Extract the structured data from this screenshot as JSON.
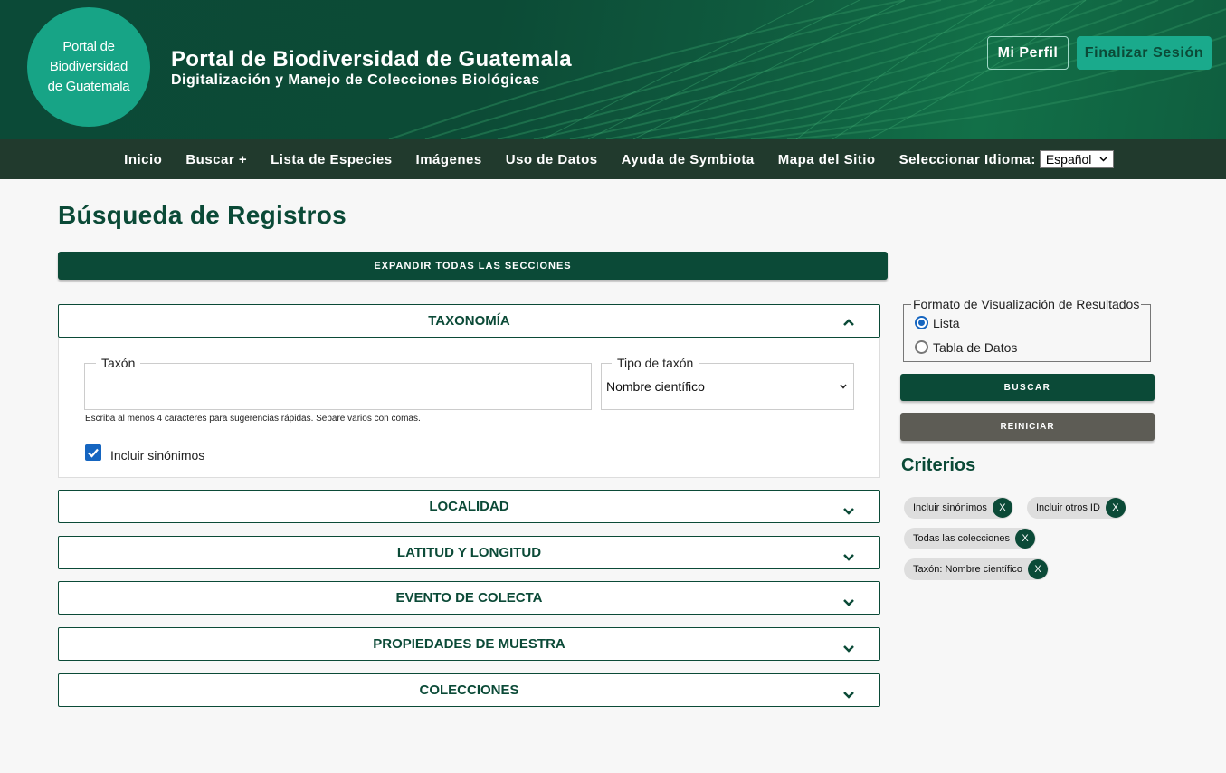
{
  "header": {
    "logo_lines": [
      "Portal de",
      "Biodiversidad",
      "de Guatemala"
    ],
    "title": "Portal de Biodiversidad de Guatemala",
    "subtitle": "Digitalización y Manejo de Colecciones Biológicas",
    "profile_label": "Mi Perfil",
    "logout_label": "Finalizar Sesión"
  },
  "nav": {
    "items": [
      "Inicio",
      "Buscar +",
      "Lista de Especies",
      "Imágenes",
      "Uso de Datos",
      "Ayuda de Symbiota",
      "Mapa del Sitio"
    ],
    "language_label": "Seleccionar Idioma:",
    "language_value": "Español"
  },
  "page": {
    "title": "Búsqueda de Registros",
    "expand_all": "EXPANDIR TODAS LAS SECCIONES"
  },
  "taxonomy": {
    "title": "TAXONOMÍA",
    "taxon_label": "Taxón",
    "taxon_value": "",
    "type_label": "Tipo de taxón",
    "type_value": "Nombre científico",
    "hint": "Escriba al menos 4 caracteres para sugerencias rápidas. Separe varios con comas.",
    "synonyms_label": "Incluir sinónimos"
  },
  "sections": [
    "LOCALIDAD",
    "LATITUD Y LONGITUD",
    "EVENTO DE COLECTA",
    "PROPIEDADES DE MUESTRA",
    "COLECCIONES"
  ],
  "format": {
    "legend": "Formato de Visualización de Resultados",
    "options": [
      "Lista",
      "Tabla de Datos"
    ],
    "selected": "Lista"
  },
  "buttons": {
    "search": "BUSCAR",
    "reset": "REINICIAR"
  },
  "criteria": {
    "title": "Criterios",
    "chips": [
      "Incluir sinónimos",
      "Incluir otros ID",
      "Todas las colecciones",
      "Taxón: Nombre científico"
    ],
    "remove_label": "X"
  },
  "colors": {
    "primary": "#0b4a37",
    "nav_bg": "#213a2d",
    "accent": "#1aaa8c",
    "reset_bg": "#5d5c55"
  }
}
